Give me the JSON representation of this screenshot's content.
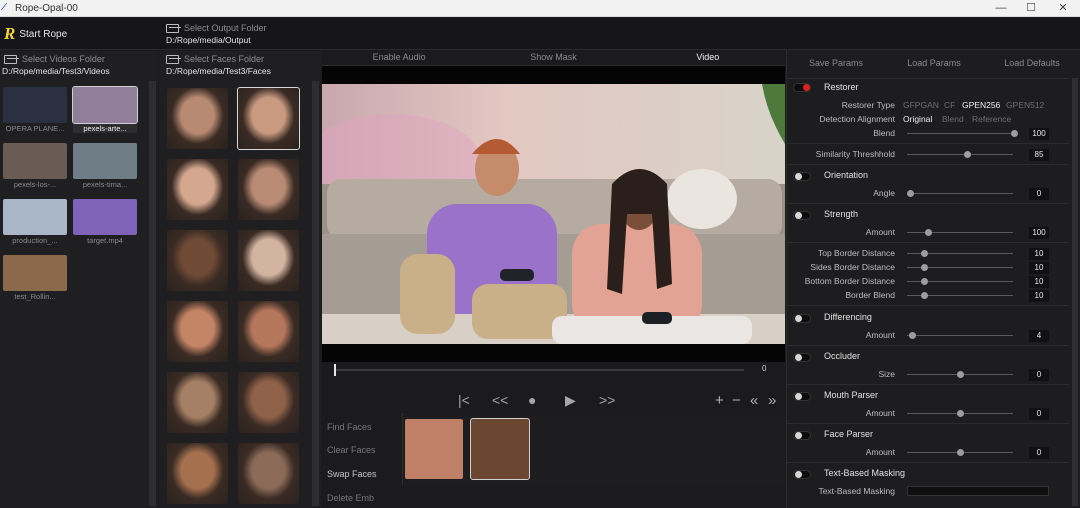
{
  "window": {
    "title": "Rope-Opal-00",
    "min": "—",
    "max": "☐",
    "close": "✕"
  },
  "top": {
    "start_label": "Start Rope",
    "logo": "R",
    "output_label": "Select Output Folder",
    "output_path": "D:/Rope/media/Output"
  },
  "videos": {
    "label": "Select Videos Folder",
    "path": "D:/Rope/media/Test3/Videos",
    "items": [
      {
        "name": "OPERA PLANE...",
        "color": "#2a3040"
      },
      {
        "name": "pexels-arte...",
        "color": "#8f7f9a"
      },
      {
        "name": "pexels-los-...",
        "color": "#6a5b55"
      },
      {
        "name": "pexels-tima...",
        "color": "#6e7d86"
      },
      {
        "name": "production_...",
        "color": "#a8b6c8"
      },
      {
        "name": "target.mp4",
        "color": "#7e63b8"
      },
      {
        "name": "test_Rollin...",
        "color": "#8a6a4a"
      }
    ]
  },
  "faces": {
    "label": "Select Faces Folder",
    "path": "D:/Rope/media/Test3/Faces",
    "colors": [
      "#b98a72",
      "#c99a80",
      "#d4a88f",
      "#b98b74",
      "#6f4a34",
      "#d3b4a1",
      "#c48466",
      "#b5775c",
      "#a58064",
      "#8f6149",
      "#a5704e",
      "#8b6a58"
    ]
  },
  "video": {
    "tabs": [
      "Enable Audio",
      "Show Mask",
      "Video"
    ],
    "frame": "0",
    "buttons": [
      "Find Faces",
      "Clear Faces",
      "Swap Faces",
      "Delete Emb"
    ],
    "controls": {
      "start": "|<",
      "back": "<<",
      "stop": "●",
      "play": "▶",
      "forward": ">>",
      "add": "+",
      "remove": "−",
      "prev_marker": "«",
      "next_marker": "»"
    }
  },
  "params": {
    "tabs": [
      "Save Params",
      "Load Params",
      "Load Defaults"
    ],
    "restorer": {
      "title": "Restorer",
      "type_label": "Restorer Type",
      "types": [
        "GFPGAN",
        "CF",
        "GPEN256",
        "GPEN512"
      ],
      "selected_type": "GPEN256",
      "align_label": "Detection Alignment",
      "aligns": [
        "Original",
        "Blend",
        "Reference"
      ],
      "selected_align": "Original",
      "blend_label": "Blend",
      "blend": "100"
    },
    "similarity": {
      "label": "Similarity Threshhold",
      "value": "85"
    },
    "orientation": {
      "title": "Orientation",
      "label": "Angle",
      "value": "0"
    },
    "strength": {
      "title": "Strength",
      "label": "Amount",
      "value": "100"
    },
    "borders": [
      {
        "label": "Top Border Distance",
        "value": "10"
      },
      {
        "label": "Sides Border Distance",
        "value": "10"
      },
      {
        "label": "Bottom Border Distance",
        "value": "10"
      },
      {
        "label": "Border Blend",
        "value": "10"
      }
    ],
    "differencing": {
      "title": "Differencing",
      "label": "Amount",
      "value": "4"
    },
    "occluder": {
      "title": "Occluder",
      "label": "Size",
      "value": "0"
    },
    "mouth": {
      "title": "Mouth Parser",
      "label": "Amount",
      "value": "0"
    },
    "face": {
      "title": "Face Parser",
      "label": "Amount",
      "value": "0"
    },
    "textmask": {
      "title": "Text-Based Masking",
      "label": "Text-Based Masking"
    }
  }
}
